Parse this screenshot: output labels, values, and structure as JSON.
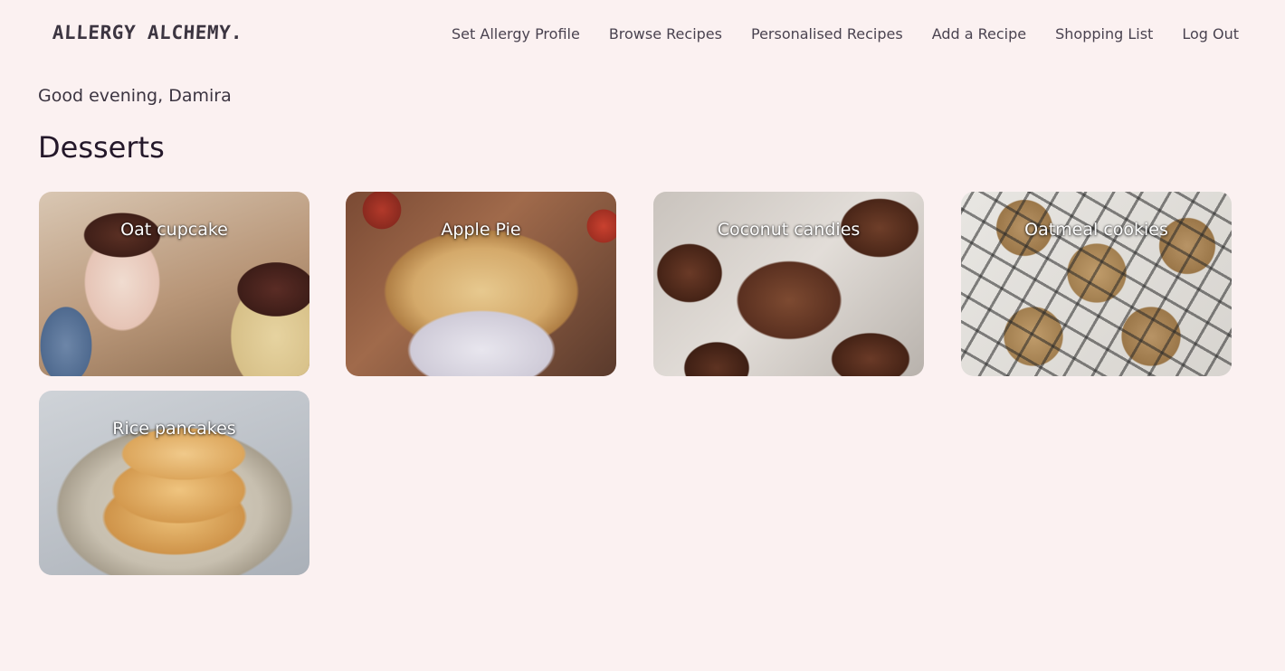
{
  "header": {
    "logo_text": "ALLERGY ALCHEMY.",
    "nav": [
      {
        "label": "Set Allergy Profile"
      },
      {
        "label": "Browse Recipes"
      },
      {
        "label": "Personalised Recipes"
      },
      {
        "label": "Add a Recipe"
      },
      {
        "label": "Shopping List"
      },
      {
        "label": "Log Out"
      }
    ]
  },
  "main": {
    "greeting": "Good evening, Damira",
    "section_title": "Desserts",
    "recipes": [
      {
        "title": "Oat cupcake"
      },
      {
        "title": "Apple Pie"
      },
      {
        "title": "Coconut candies"
      },
      {
        "title": "Oatmeal cookies"
      },
      {
        "title": "Rice pancakes"
      }
    ]
  },
  "colors": {
    "background": "#fbf1f1",
    "text": "#2a2230"
  }
}
